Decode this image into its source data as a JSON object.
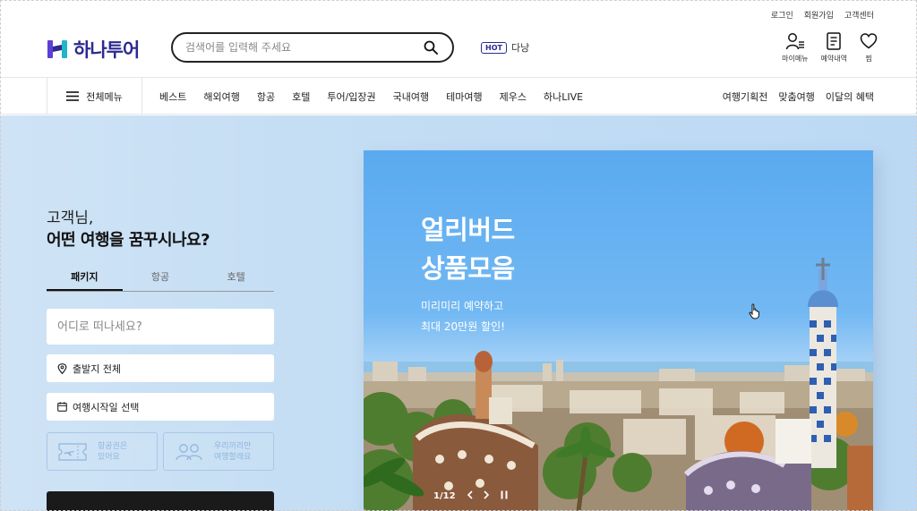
{
  "header": {
    "util_links": [
      "로그인",
      "회원가입",
      "고객센터"
    ],
    "logo_text": "하나투어",
    "search": {
      "placeholder": "검색어를 입력해 주세요"
    },
    "hot": {
      "badge": "HOT",
      "keyword": "다낭"
    },
    "icon_menu": [
      {
        "label": "마이메뉴",
        "icon": "user-menu-icon"
      },
      {
        "label": "예약내역",
        "icon": "document-icon"
      },
      {
        "label": "찜",
        "icon": "heart-icon"
      }
    ]
  },
  "nav": {
    "all_menu": "전체메뉴",
    "main": [
      "베스트",
      "해외여행",
      "항공",
      "호텔",
      "투어/입장권",
      "국내여행",
      "테마여행",
      "제우스",
      "하나LIVE"
    ],
    "right": [
      "여행기획전",
      "맞춤여행",
      "이달의 혜택"
    ]
  },
  "hero": {
    "greeting_line1": "고객님,",
    "greeting_line2": "어떤 여행을 꿈꾸시나요?",
    "tabs": [
      "패키지",
      "항공",
      "호텔"
    ],
    "active_tab": "패키지",
    "destination_placeholder": "어디로 떠나세요?",
    "departure_label": "출발지 전체",
    "date_label": "여행시작일 선택",
    "options": [
      {
        "line1": "항공권은",
        "line2": "있어요",
        "icon": "plane-ticket-icon"
      },
      {
        "line1": "우리끼리만",
        "line2": "여행할래요",
        "icon": "group-icon"
      }
    ]
  },
  "banner": {
    "title_line1": "얼리버드",
    "title_line2": "상품모음",
    "sub_line1": "미리미리 예약하고",
    "sub_line2": "최대 20만원 할인!",
    "pager_text": "1/12"
  },
  "colors": {
    "brand_navy": "#2d2a8f",
    "hero_bg": "#c3ddf4",
    "banner_sky": "#5aaaf0",
    "search_button": "#1a1a1a"
  }
}
